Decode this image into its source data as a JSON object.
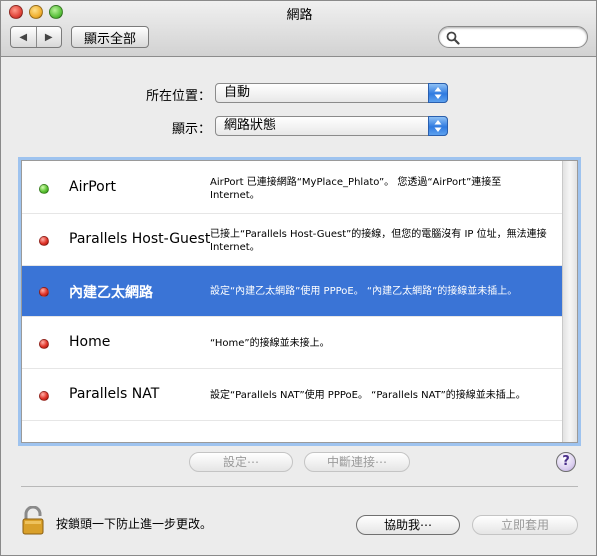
{
  "window": {
    "title": "網路"
  },
  "toolbar": {
    "back_label": "◀",
    "forward_label": "▶",
    "show_all_label": "顯示全部",
    "search_placeholder": ""
  },
  "location": {
    "label": "所在位置：",
    "value": "自動"
  },
  "show": {
    "label": "顯示：",
    "value": "網路狀態"
  },
  "services": [
    {
      "name": "AirPort",
      "status": "green",
      "selected": false,
      "description": "AirPort 已連接網路“MyPlace_Phlato”。 您透過“AirPort”連接至 Internet。"
    },
    {
      "name": "Parallels Host-Guest",
      "status": "red",
      "selected": false,
      "description": "已接上“Parallels Host-Guest”的接線，但您的電腦沒有 IP 位址，無法連接 Internet。"
    },
    {
      "name": "內建乙太網路",
      "status": "red",
      "selected": true,
      "description": "設定“內建乙太網路”使用 PPPoE。 “內建乙太網路”的接線並未插上。"
    },
    {
      "name": "Home",
      "status": "red",
      "selected": false,
      "description": "“Home”的接線並未接上。"
    },
    {
      "name": "Parallels NAT",
      "status": "red",
      "selected": false,
      "description": "設定“Parallels NAT”使用 PPPoE。 “Parallels NAT”的接線並未插上。"
    }
  ],
  "buttons": {
    "configure": "設定⋯",
    "disconnect": "中斷連接⋯",
    "help": "?",
    "assist": "協助我⋯",
    "apply": "立即套用"
  },
  "lock": {
    "text": "按鎖頭一下防止進一步更改。"
  },
  "colors": {
    "selection": "#3a74d6",
    "status_green": "#5cc233",
    "status_red": "#e03328"
  }
}
